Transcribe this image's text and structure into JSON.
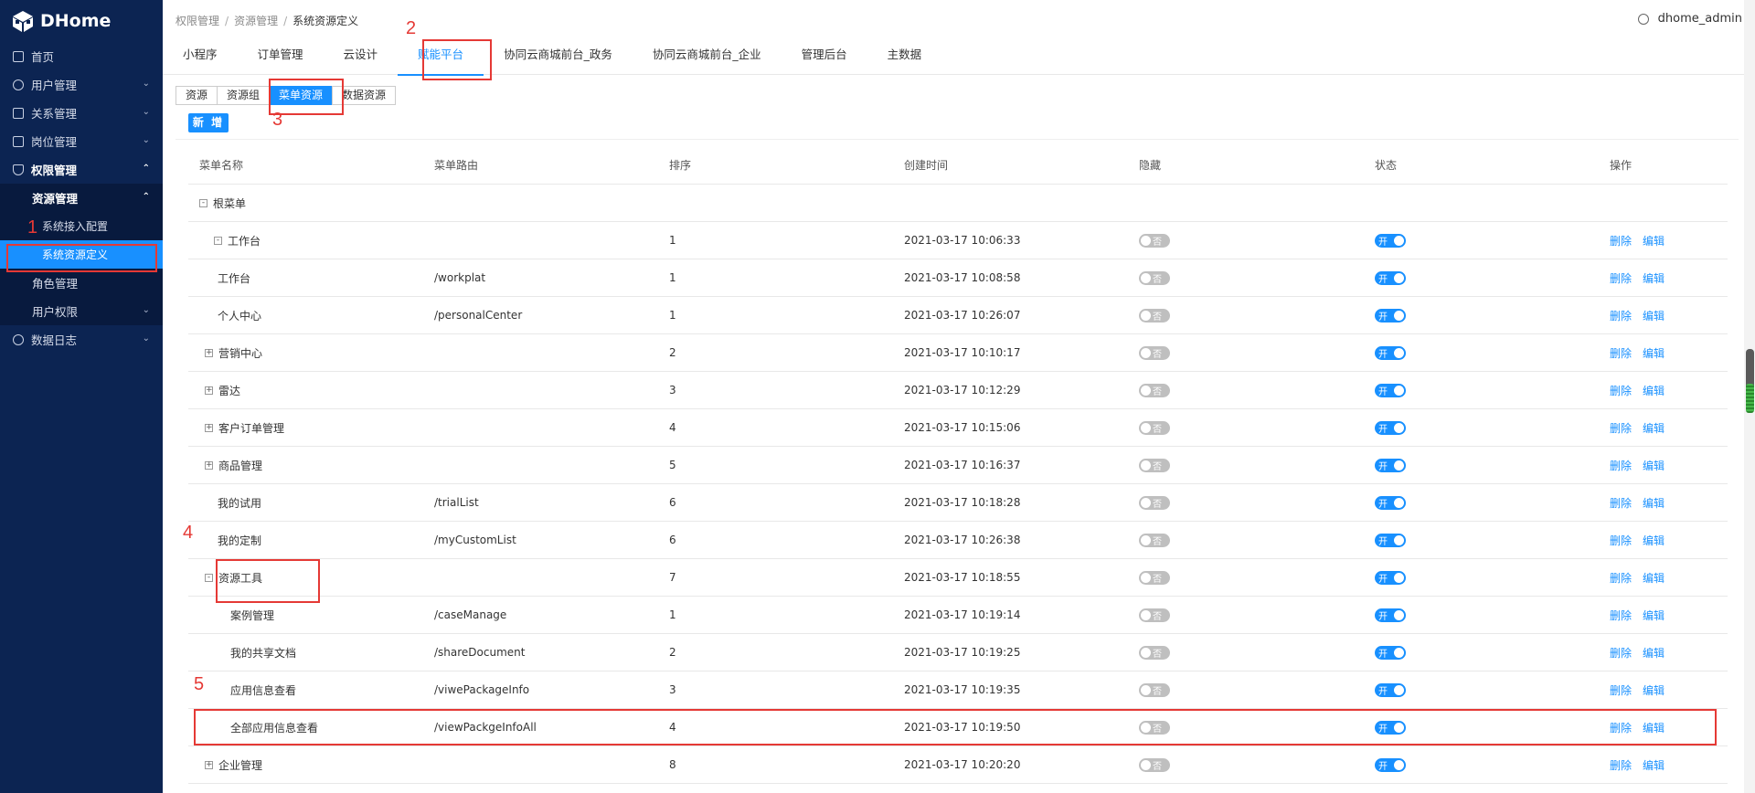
{
  "app": {
    "logo": "DHome"
  },
  "sidebar": {
    "items": [
      {
        "label": "首页",
        "icon": "home-icon"
      },
      {
        "label": "用户管理",
        "icon": "user-icon",
        "chev": "⌄"
      },
      {
        "label": "关系管理",
        "icon": "relation-icon",
        "chev": "⌄"
      },
      {
        "label": "岗位管理",
        "icon": "post-icon",
        "chev": "⌄"
      },
      {
        "label": "权限管理",
        "icon": "shield-icon",
        "chev": "⌃"
      }
    ],
    "resource_group": {
      "label": "资源管理",
      "chev": "⌃"
    },
    "resource_children": [
      "系统接入配置",
      "系统资源定义"
    ],
    "role": "角色管理",
    "user_perm": {
      "label": "用户权限",
      "chev": "⌄"
    },
    "data_log": {
      "label": "数据日志",
      "icon": "log-icon",
      "chev": "⌄"
    }
  },
  "breadcrumb": [
    "权限管理",
    "资源管理",
    "系统资源定义"
  ],
  "user": {
    "name": "dhome_admin"
  },
  "tabs": [
    "小程序",
    "订单管理",
    "云设计",
    "赋能平台",
    "协同云商城前台_政务",
    "协同云商城前台_企业",
    "管理后台",
    "主数据"
  ],
  "subtabs": [
    "资源",
    "资源组",
    "菜单资源",
    "数据资源"
  ],
  "add_button": "新 增",
  "table": {
    "headers": [
      "菜单名称",
      "菜单路由",
      "排序",
      "创建时间",
      "隐藏",
      "状态",
      "操作"
    ],
    "hide_label": "否",
    "status_label": "开",
    "ops": [
      "删除",
      "编辑"
    ],
    "root": {
      "name": "根菜单",
      "expander": "-"
    },
    "rows": [
      {
        "name": "工作台",
        "route": "",
        "sort": "1",
        "time": "2021-03-17 10:06:33",
        "level": 1,
        "expander": "-"
      },
      {
        "name": "工作台",
        "route": "/workplat",
        "sort": "1",
        "time": "2021-03-17 10:08:58",
        "level": 2,
        "expander": ""
      },
      {
        "name": "个人中心",
        "route": "/personalCenter",
        "sort": "1",
        "time": "2021-03-17 10:26:07",
        "level": 2,
        "expander": ""
      },
      {
        "name": "营销中心",
        "route": "",
        "sort": "2",
        "time": "2021-03-17 10:10:17",
        "level": 2,
        "expander": "+"
      },
      {
        "name": "雷达",
        "route": "",
        "sort": "3",
        "time": "2021-03-17 10:12:29",
        "level": 2,
        "expander": "+"
      },
      {
        "name": "客户订单管理",
        "route": "",
        "sort": "4",
        "time": "2021-03-17 10:15:06",
        "level": 2,
        "expander": "+"
      },
      {
        "name": "商品管理",
        "route": "",
        "sort": "5",
        "time": "2021-03-17 10:16:37",
        "level": 2,
        "expander": "+"
      },
      {
        "name": "我的试用",
        "route": "/trialList",
        "sort": "6",
        "time": "2021-03-17 10:18:28",
        "level": 2,
        "expander": ""
      },
      {
        "name": "我的定制",
        "route": "/myCustomList",
        "sort": "6",
        "time": "2021-03-17 10:26:38",
        "level": 2,
        "expander": ""
      },
      {
        "name": "资源工具",
        "route": "",
        "sort": "7",
        "time": "2021-03-17 10:18:55",
        "level": 2,
        "expander": "-"
      },
      {
        "name": "案例管理",
        "route": "/caseManage",
        "sort": "1",
        "time": "2021-03-17 10:19:14",
        "level": 3,
        "expander": ""
      },
      {
        "name": "我的共享文档",
        "route": "/shareDocument",
        "sort": "2",
        "time": "2021-03-17 10:19:25",
        "level": 3,
        "expander": ""
      },
      {
        "name": "应用信息查看",
        "route": "/viwePackageInfo",
        "sort": "3",
        "time": "2021-03-17 10:19:35",
        "level": 3,
        "expander": ""
      },
      {
        "name": "全部应用信息查看",
        "route": "/viewPackgeInfoAll",
        "sort": "4",
        "time": "2021-03-17 10:19:50",
        "level": 3,
        "expander": ""
      },
      {
        "name": "企业管理",
        "route": "",
        "sort": "8",
        "time": "2021-03-17 10:20:20",
        "level": 2,
        "expander": "+"
      }
    ]
  },
  "annotations": [
    "1",
    "2",
    "3",
    "4",
    "5"
  ],
  "colors": {
    "sidebar": "#0c2452",
    "accent": "#1890ff",
    "annotation": "#e53935"
  }
}
